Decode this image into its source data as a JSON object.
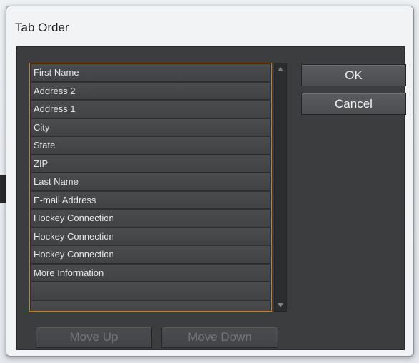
{
  "dialog": {
    "title": "Tab Order",
    "ok_label": "OK",
    "cancel_label": "Cancel",
    "move_up_label": "Move Up",
    "move_down_label": "Move Down"
  },
  "list": {
    "items": [
      "First Name",
      "Address 2",
      "Address 1",
      "City",
      "State",
      "ZIP",
      "Last Name",
      "E-mail Address",
      "Hockey Connection",
      "Hockey Connection",
      "Hockey Connection",
      "More Information"
    ]
  },
  "icons": {
    "scroll_up": "scroll-up-arrow-icon",
    "scroll_down": "scroll-down-arrow-icon"
  },
  "colors": {
    "panel_bg": "#3b3d3f",
    "list_border_accent": "#c07d2e",
    "button_bg": "#54565a",
    "disabled_text": "#737578"
  }
}
